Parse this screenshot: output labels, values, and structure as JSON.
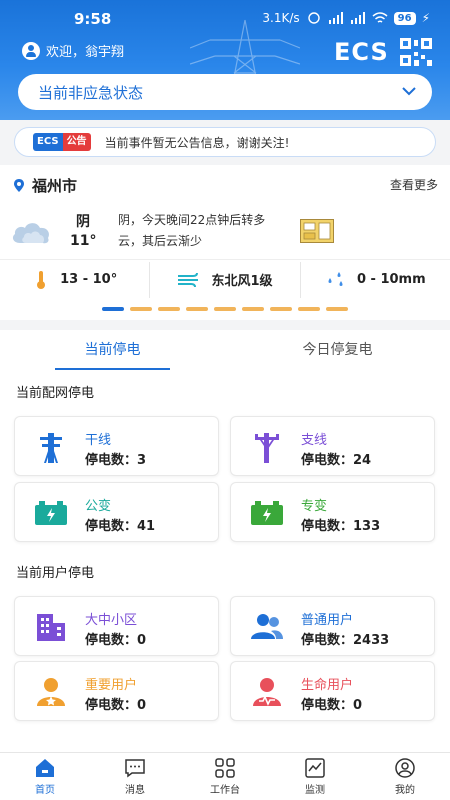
{
  "status_bar": {
    "time": "9:58",
    "network_speed": "3.1K/s",
    "battery": "96"
  },
  "header": {
    "welcome": "欢迎，翁宇翔",
    "logo_text": "ECS",
    "emergency_status": "当前非应急状态"
  },
  "notice": {
    "badge_ecs": "ECS",
    "badge_label": "公告",
    "text": "当前事件暂无公告信息，谢谢关注!"
  },
  "weather": {
    "city": "福州市",
    "more": "查看更多",
    "condition": "阴",
    "temperature": "11°",
    "forecast": "阴，今天晚间22点钟后转多云，其后云渐少",
    "temp_range": "13 - 10°",
    "wind": "东北风1级",
    "rain": "0 - 10mm",
    "carousel_pages": 9,
    "carousel_active": 0
  },
  "tabs": [
    {
      "label": "当前停电",
      "active": true
    },
    {
      "label": "今日停复电",
      "active": false
    }
  ],
  "distribution": {
    "title": "当前配网停电",
    "cards": [
      {
        "name": "干线",
        "count": "停电数：3",
        "color": "#1e6fd6",
        "icon": "transmission-tower-icon"
      },
      {
        "name": "支线",
        "count": "停电数：24",
        "color": "#7b4fd6",
        "icon": "utility-pole-icon"
      },
      {
        "name": "公变",
        "count": "停电数：41",
        "color": "#1aaa9c",
        "icon": "battery-charge-icon"
      },
      {
        "name": "专变",
        "count": "停电数：133",
        "color": "#3aa83a",
        "icon": "battery-charge-icon"
      }
    ]
  },
  "users": {
    "title": "当前用户停电",
    "cards": [
      {
        "name": "大中小区",
        "count": "停电数：0",
        "color": "#7b4fd6",
        "icon": "building-icon"
      },
      {
        "name": "普通用户",
        "count": "停电数：2433",
        "color": "#1e6fd6",
        "icon": "users-icon"
      },
      {
        "name": "重要用户",
        "count": "停电数：0",
        "color": "#f0a030",
        "icon": "vip-user-icon"
      },
      {
        "name": "生命用户",
        "count": "停电数：0",
        "color": "#e8505b",
        "icon": "life-user-icon"
      }
    ]
  },
  "bottom_nav": [
    {
      "label": "首页",
      "icon": "home-icon",
      "active": true
    },
    {
      "label": "消息",
      "icon": "message-icon",
      "active": false
    },
    {
      "label": "工作台",
      "icon": "grid-icon",
      "active": false
    },
    {
      "label": "监测",
      "icon": "monitor-icon",
      "active": false
    },
    {
      "label": "我的",
      "icon": "profile-icon",
      "active": false
    }
  ],
  "colors": {
    "primary": "#1e6fd6",
    "header_bg": "#2a86ea",
    "carousel_inactive": "#f1b45a"
  }
}
